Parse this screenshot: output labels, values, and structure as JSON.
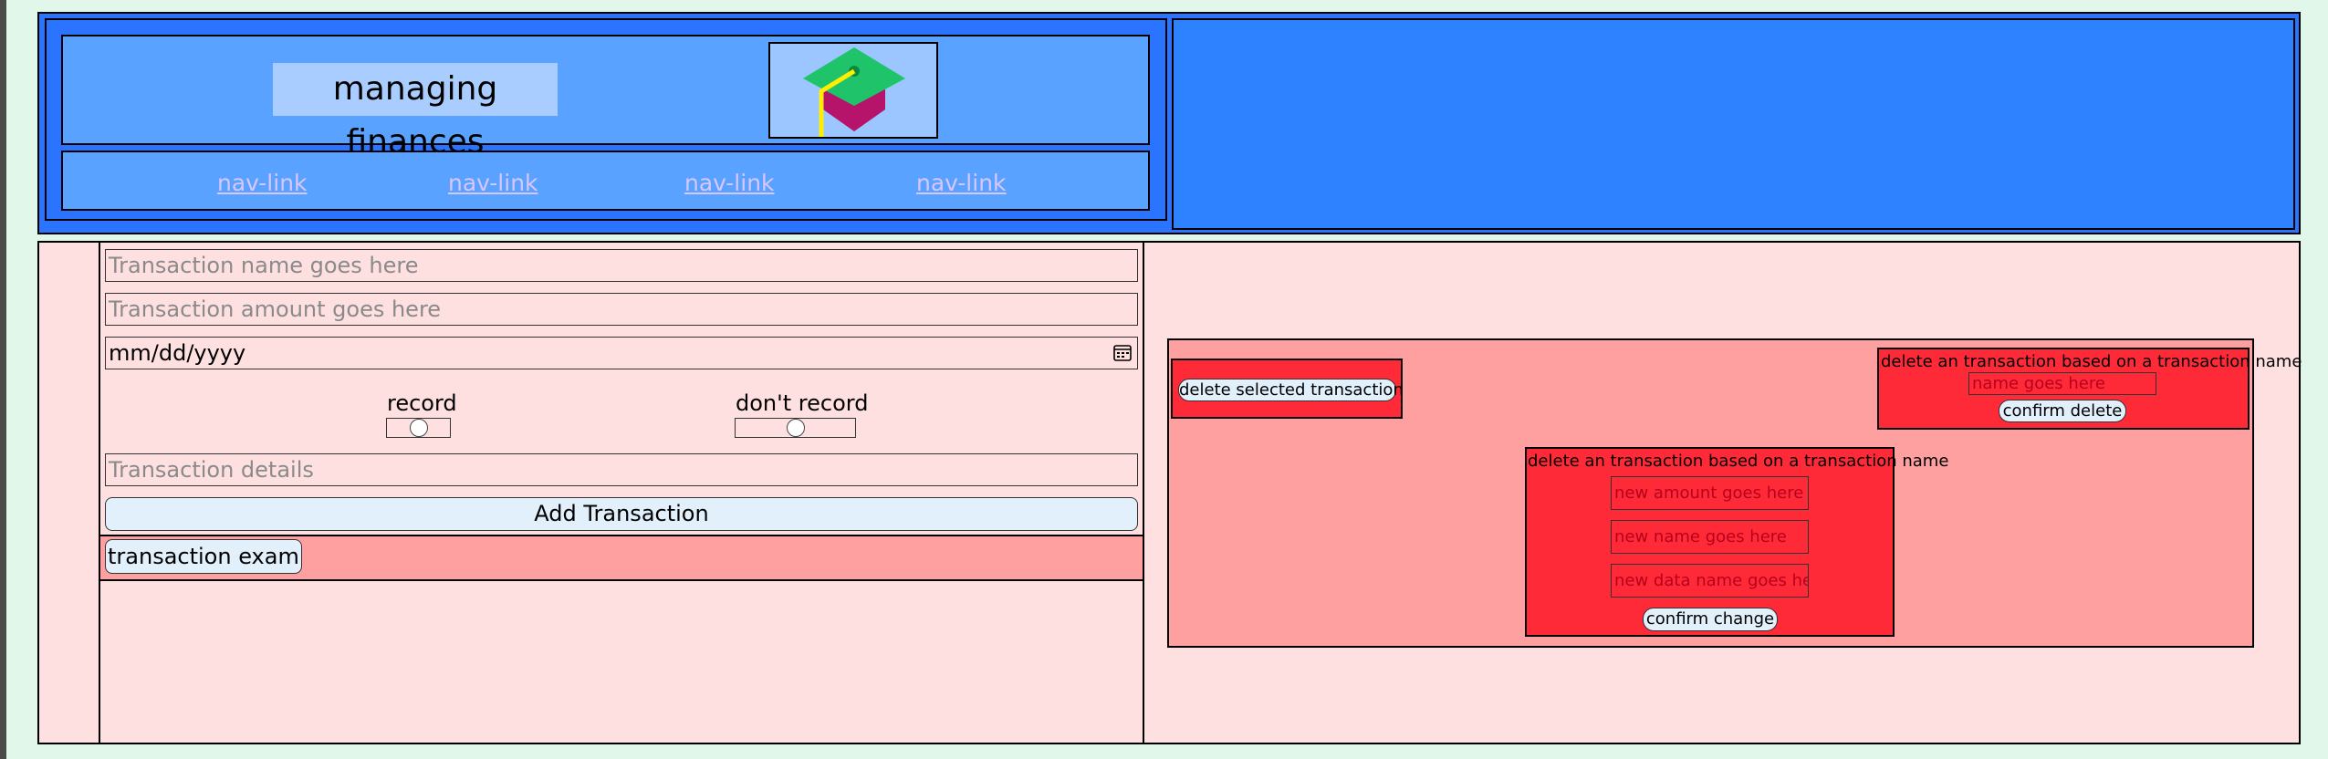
{
  "header": {
    "title": "managing finances",
    "logo_icon": "graduation-cap-icon",
    "nav": [
      {
        "label": "nav-link"
      },
      {
        "label": "nav-link"
      },
      {
        "label": "nav-link"
      },
      {
        "label": "nav-link"
      }
    ]
  },
  "form": {
    "name_placeholder": "Transaction name goes here",
    "amount_placeholder": "Transaction amount goes here",
    "date_value": "mm/dd/yyyy",
    "calendar_icon": "calendar-icon",
    "radio_record_label": "record",
    "radio_dont_record_label": "don't record",
    "details_placeholder": "Transaction details",
    "add_button": "Add Transaction"
  },
  "transactions": [
    {
      "label": "transaction example"
    }
  ],
  "actions": {
    "delete_selected": "delete selected transaction",
    "delete_by_name": {
      "title": "delete an transaction based on a transaction name",
      "name_placeholder": "name goes here",
      "confirm": "confirm delete"
    },
    "change": {
      "title": "delete an transaction based on a transaction name",
      "amount_placeholder": "new amount goes here",
      "name_placeholder": "new name goes here",
      "data_placeholder": "new data name goes here",
      "confirm": "confirm change"
    }
  },
  "colors": {
    "header_blue": "#2a74ff",
    "panel_blue": "#59a2ff",
    "main_pink": "#ffe0e0",
    "salmon": "#ffa0a0",
    "red": "#ff2a38",
    "button_bg": "#e1f0fb"
  }
}
